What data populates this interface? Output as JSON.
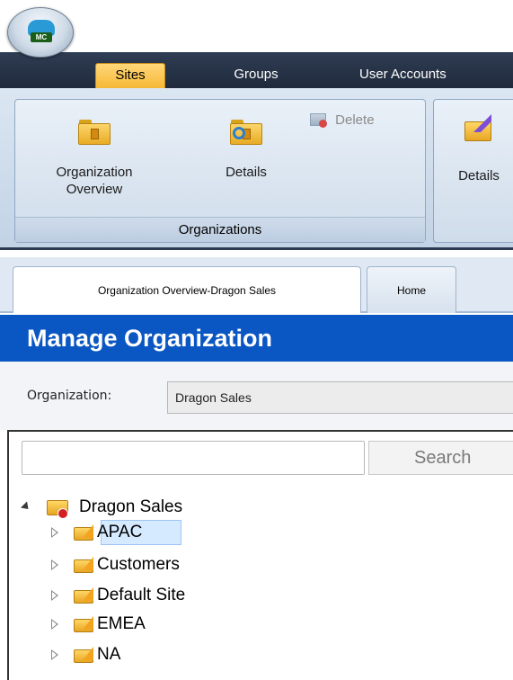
{
  "app": {
    "logo_text": "MC"
  },
  "ribbon": {
    "tabs": [
      {
        "label": "Sites",
        "active": true
      },
      {
        "label": "Groups",
        "active": false
      },
      {
        "label": "User Accounts",
        "active": false
      }
    ],
    "groups": [
      {
        "label": "Organizations",
        "buttons": [
          {
            "label_line1": "Organization",
            "label_line2": "Overview",
            "icon": "org-folder-icon"
          },
          {
            "label_line1": "Details",
            "label_line2": "",
            "icon": "details-folder-icon"
          }
        ],
        "small_buttons": [
          {
            "label": "Delete",
            "icon": "delete-icon",
            "enabled": false
          }
        ]
      },
      {
        "label": "",
        "buttons": [
          {
            "label_line1": "Details",
            "label_line2": "",
            "icon": "site-details-icon"
          }
        ]
      }
    ]
  },
  "doc_tabs": [
    {
      "label": "Organization Overview-Dragon Sales",
      "active": true
    },
    {
      "label": "Home",
      "active": false
    }
  ],
  "page": {
    "title": "Manage Organization",
    "org_label": "Organization:",
    "org_value": "Dragon Sales"
  },
  "search": {
    "value": "",
    "placeholder": "",
    "button_label": "Search"
  },
  "tree": {
    "root": {
      "label": "Dragon Sales",
      "expanded": true,
      "icon": "organization-icon"
    },
    "children": [
      {
        "label": "APAC",
        "selected": true,
        "icon": "site-icon"
      },
      {
        "label": "Customers",
        "selected": false,
        "icon": "site-icon"
      },
      {
        "label": "Default Site",
        "selected": false,
        "icon": "site-icon"
      },
      {
        "label": "EMEA",
        "selected": false,
        "icon": "site-icon"
      },
      {
        "label": "NA",
        "selected": false,
        "icon": "site-icon"
      }
    ]
  },
  "colors": {
    "header_blue": "#0a56c2",
    "ribbon_dark": "#1f2a3c",
    "active_tab": "#f6b835"
  }
}
